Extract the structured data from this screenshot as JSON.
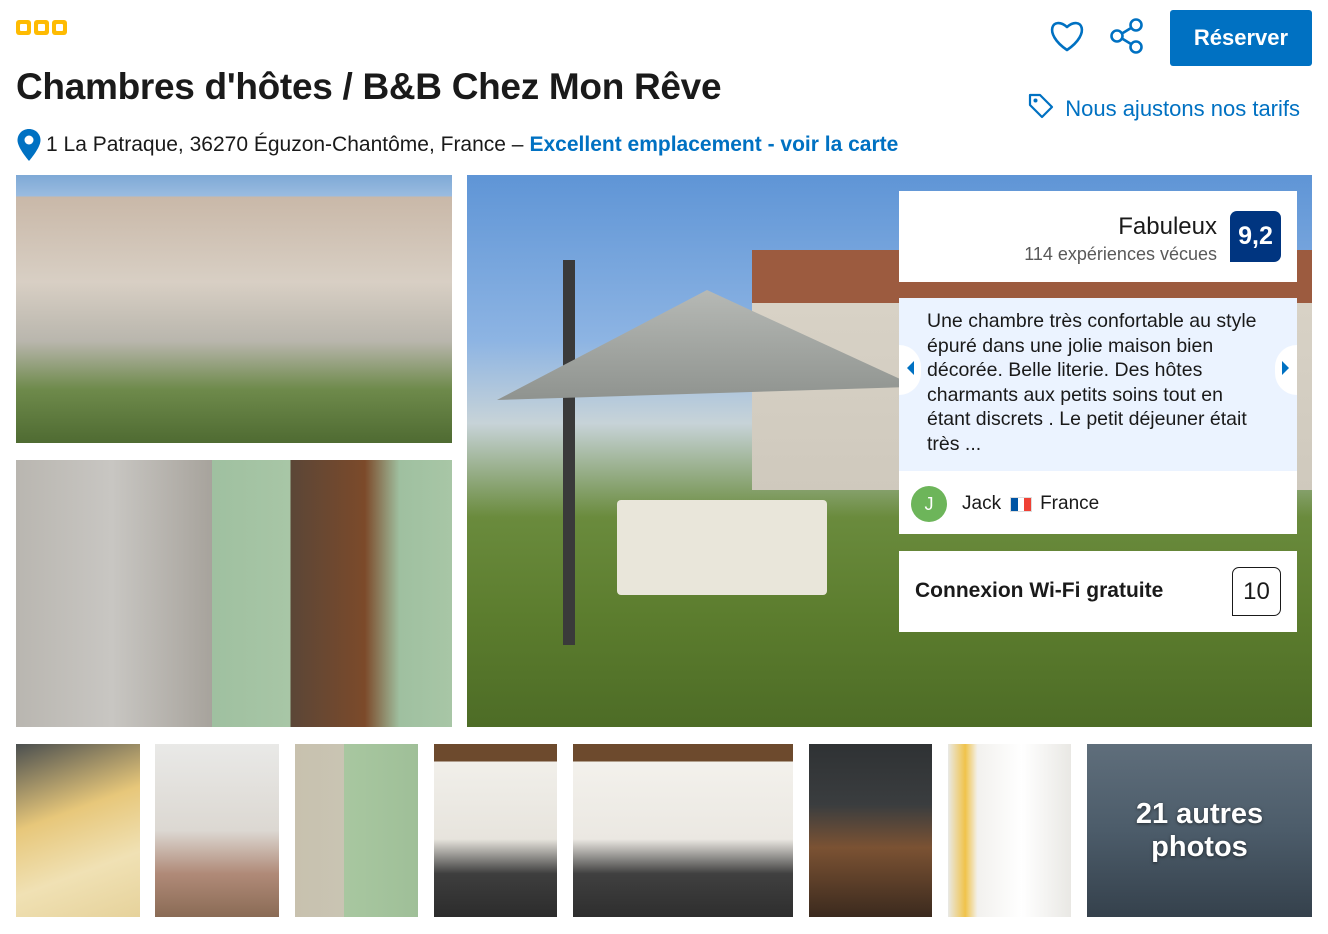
{
  "header": {
    "stars": 3,
    "title": "Chambres d'hôtes / B&B Chez Mon Rêve",
    "address": "1 La Patraque, 36270 Éguzon-Chantôme, France –",
    "map_link": "Excellent emplacement - voir la carte",
    "price_match": "Nous ajustons nos tarifs",
    "reserve_label": "Réserver",
    "icons": {
      "favorite": "heart-icon",
      "share": "share-icon",
      "location": "map-pin-icon",
      "price": "tag-icon"
    }
  },
  "rating": {
    "word": "Fabuleux",
    "count": "114 expériences vécues",
    "score": "9,2"
  },
  "review": {
    "text": "Une chambre très confortable au style épuré dans une jolie maison bien décorée. Belle literie. Des hôtes charmants aux petits soins tout en étant discrets . Le petit déjeuner était très ...",
    "reviewer_initial": "J",
    "reviewer_name": "Jack",
    "reviewer_country": "France"
  },
  "amenity": {
    "label": "Connexion Wi-Fi gratuite",
    "score": "10"
  },
  "gallery": {
    "more_photos_line1": "21 autres",
    "more_photos_line2": "photos"
  },
  "colors": {
    "primary": "#0071c2",
    "score_badge": "#003580",
    "stars": "#febb02",
    "review_bg": "#ebf3ff",
    "avatar": "#6db55a"
  }
}
